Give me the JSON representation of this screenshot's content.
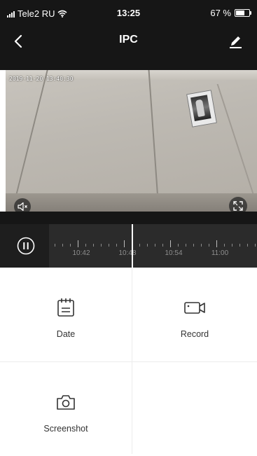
{
  "status_bar": {
    "carrier": "Tele2 RU",
    "time": "13:25",
    "battery": "67 %",
    "battery_level": 0.67
  },
  "nav": {
    "title": "IPC",
    "back_icon": "chevron-left-icon",
    "edit_icon": "pencil-icon"
  },
  "video": {
    "timestamp": "2019-11-20 13:40:30",
    "mute_icon": "speaker-muted-icon",
    "fullscreen_icon": "fullscreen-icon"
  },
  "timeline": {
    "pause_icon": "pause-icon",
    "labels": [
      "10:42",
      "10:48",
      "10:54",
      "11:00"
    ]
  },
  "actions": {
    "date_label": "Date",
    "record_label": "Record",
    "screenshot_label": "Screenshot"
  },
  "colors": {
    "header_bg": "#161616",
    "timeline_bg": "#2b2b2b",
    "playhead": "#ffffff"
  }
}
